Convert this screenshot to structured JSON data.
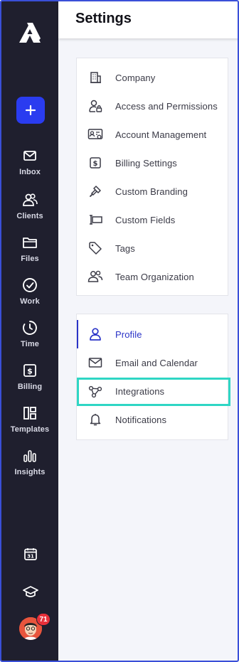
{
  "header": {
    "title": "Settings"
  },
  "rail": {
    "nav": [
      {
        "label": "Inbox",
        "icon": "inbox-icon"
      },
      {
        "label": "Clients",
        "icon": "clients-icon"
      },
      {
        "label": "Files",
        "icon": "files-icon"
      },
      {
        "label": "Work",
        "icon": "work-icon"
      },
      {
        "label": "Time",
        "icon": "time-icon"
      },
      {
        "label": "Billing",
        "icon": "billing-icon"
      },
      {
        "label": "Templates",
        "icon": "templates-icon"
      },
      {
        "label": "Insights",
        "icon": "insights-icon"
      }
    ],
    "notification_count": "71",
    "calendar_day": "31"
  },
  "firm_settings": {
    "items": [
      {
        "label": "Company",
        "icon": "building-icon"
      },
      {
        "label": "Access and Permissions",
        "icon": "user-lock-icon"
      },
      {
        "label": "Account Management",
        "icon": "id-card-gear-icon"
      },
      {
        "label": "Billing Settings",
        "icon": "dollar-doc-icon"
      },
      {
        "label": "Custom Branding",
        "icon": "brush-icon"
      },
      {
        "label": "Custom Fields",
        "icon": "custom-field-icon"
      },
      {
        "label": "Tags",
        "icon": "tag-icon"
      },
      {
        "label": "Team Organization",
        "icon": "team-icon"
      }
    ]
  },
  "personal_settings": {
    "items": [
      {
        "label": "Profile",
        "icon": "user-icon",
        "active": true
      },
      {
        "label": "Email and Calendar",
        "icon": "envelope-icon"
      },
      {
        "label": "Integrations",
        "icon": "integrations-icon",
        "highlighted": true
      },
      {
        "label": "Notifications",
        "icon": "bell-icon"
      }
    ]
  },
  "colors": {
    "rail_bg": "#1f1f2e",
    "accent": "#2a3cf0",
    "active_text": "#2a33c7",
    "highlight": "#2fd6c4",
    "badge": "#e8303a"
  }
}
